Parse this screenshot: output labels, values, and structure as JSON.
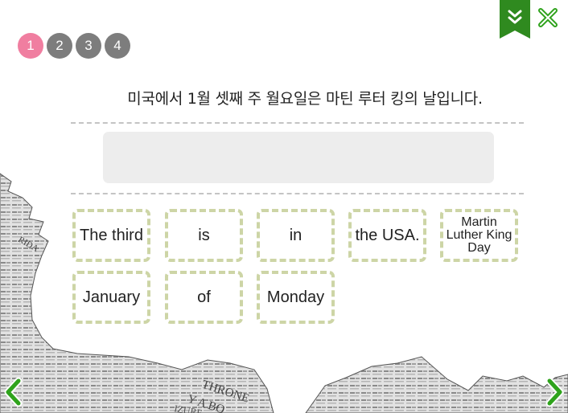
{
  "steps": [
    "1",
    "2",
    "3",
    "4"
  ],
  "question": "미국에서 1월 셋째 주 월요일은 마틴 루터 킹의 날입니다.",
  "words": [
    "The third",
    "is",
    "in",
    "the USA.",
    "Martin Luther King Day",
    "January",
    "of",
    "Monday"
  ],
  "background_text": [
    "THRONE",
    "Y A BO",
    "IZURE",
    "RIDA"
  ],
  "colors": {
    "active_step": "#f07ea0",
    "inactive_step": "#7d7d7d",
    "ribbon": "#2f8a1f",
    "tile_border": "#cdd5a6",
    "nav_green": "#2fa31c"
  }
}
